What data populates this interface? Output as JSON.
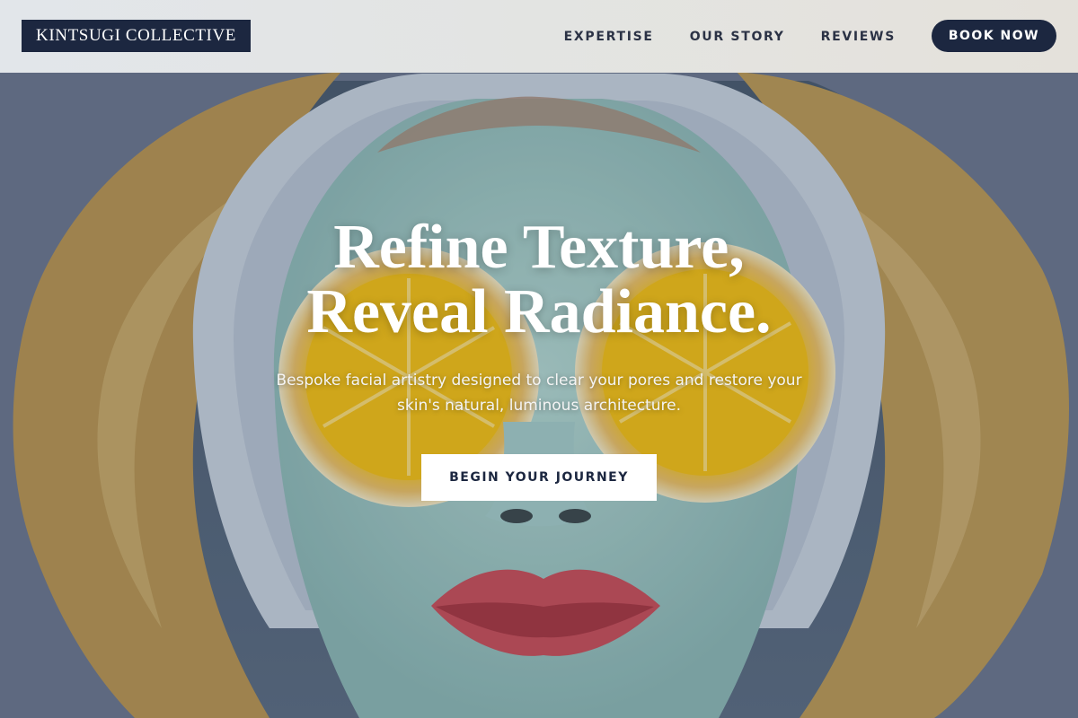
{
  "header": {
    "logo_text": "KINTSUGI COLLECTIVE",
    "nav": [
      {
        "label": "EXPERTISE"
      },
      {
        "label": "OUR STORY"
      },
      {
        "label": "REVIEWS"
      }
    ],
    "book_label": "BOOK NOW"
  },
  "hero": {
    "title_line_1": "Refine Texture,",
    "title_line_2": "Reveal Radiance.",
    "subtitle_line_1": "Bespoke facial artistry designed to clear your pores and restore your",
    "subtitle_line_2": "skin's natural, luminous architecture.",
    "cta_label": "BEGIN YOUR JOURNEY",
    "background_description": "Woman with light-blue clay face mask, white headband, and lemon slices over the eyes"
  },
  "colors": {
    "navy": "#1c2740",
    "header_bg": "#ebebe6",
    "white": "#ffffff",
    "mask_blue": "#9fc8c6",
    "lemon_yellow": "#f7c41f",
    "hair_blonde": "#b99656"
  }
}
